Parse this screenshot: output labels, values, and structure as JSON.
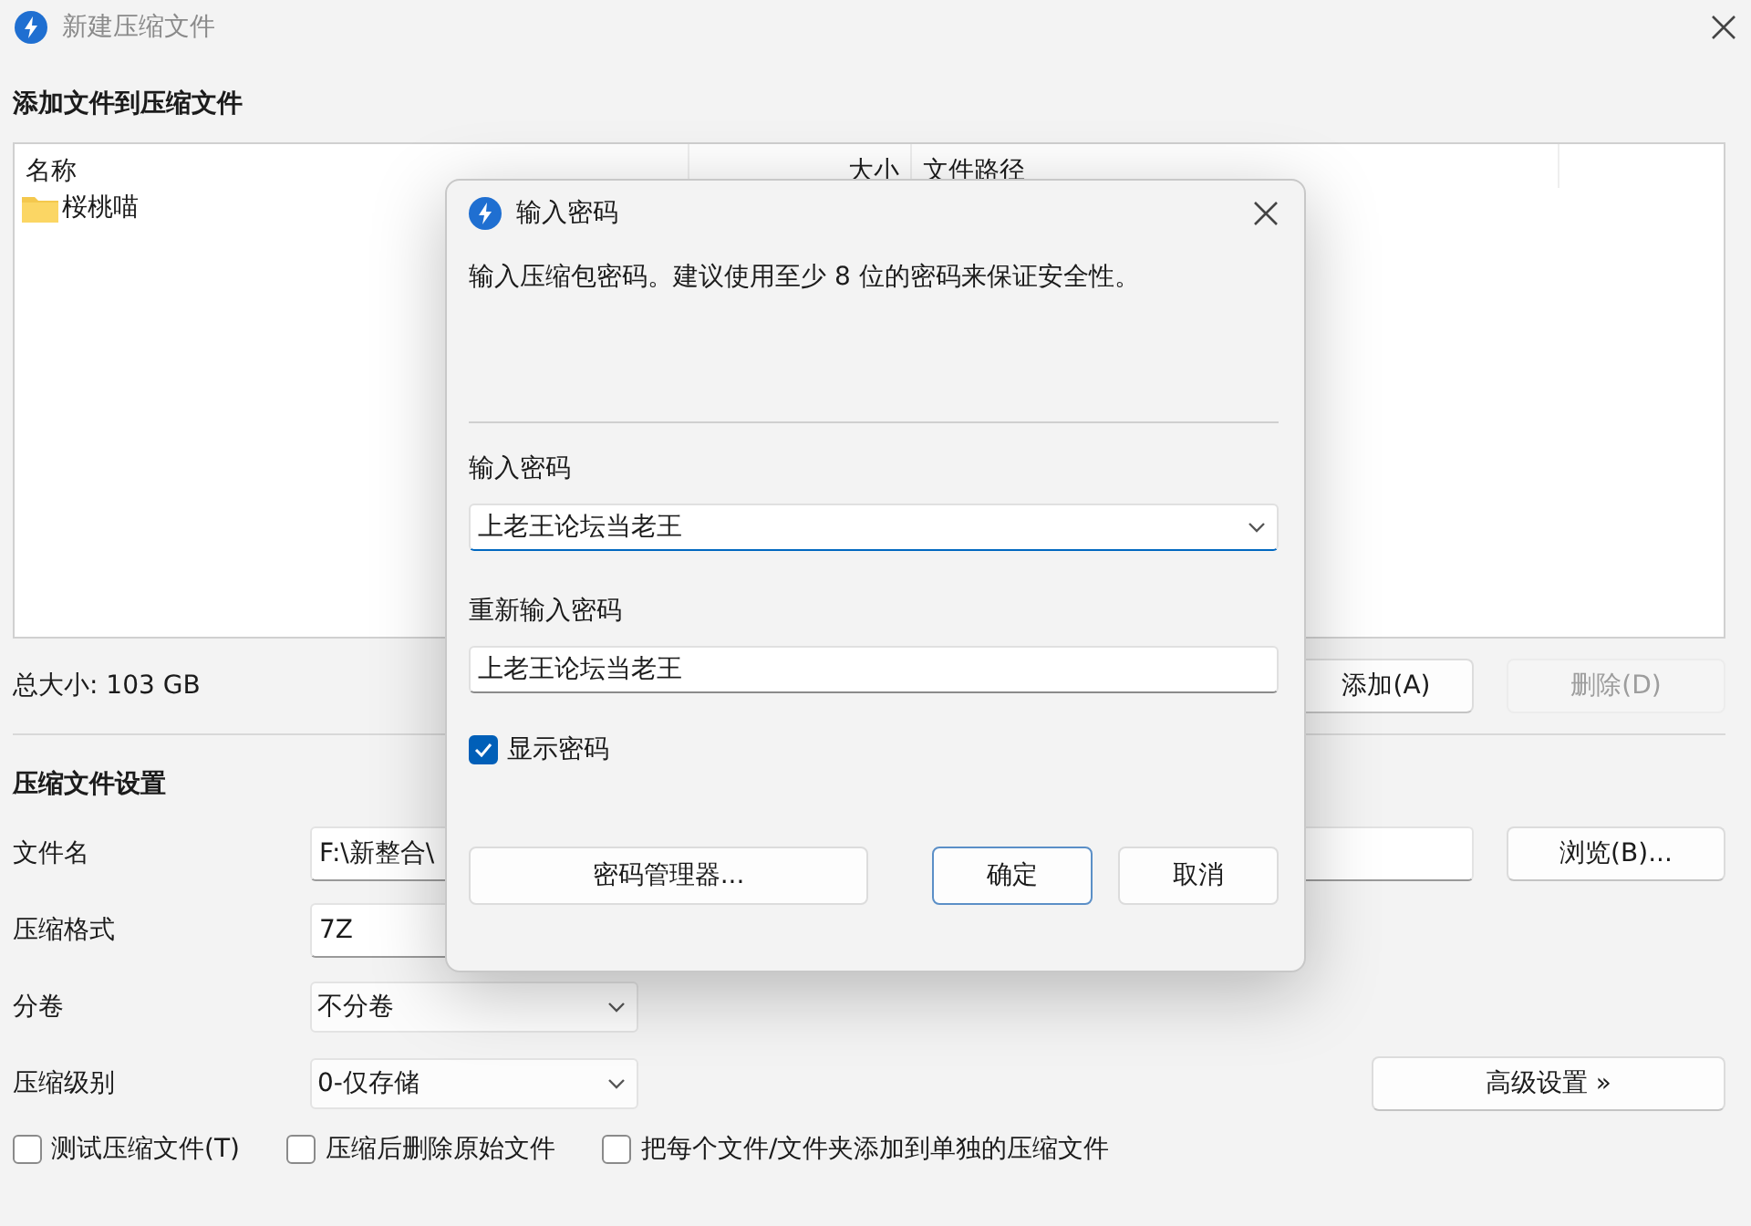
{
  "window": {
    "title": "新建压缩文件"
  },
  "files": {
    "heading": "添加文件到压缩文件",
    "columns": [
      "名称",
      "大小",
      "文件路径"
    ],
    "rows": [
      {
        "name": "桜桃喵",
        "kind": "folder"
      }
    ],
    "total": "总大小: 103 GB",
    "buttons": [
      {
        "label": "添加(A)",
        "disabled": false
      },
      {
        "label": "删除(D)",
        "disabled": true
      }
    ]
  },
  "settings": {
    "heading": "压缩文件设置",
    "fields": [
      {
        "label": "文件名",
        "kind": "text",
        "value": "F:\\新整合\\",
        "button": "浏览(B)..."
      },
      {
        "label": "压缩格式",
        "kind": "text",
        "value": "7Z"
      },
      {
        "label": "分卷",
        "kind": "select",
        "value": "不分卷"
      },
      {
        "label": "压缩级别",
        "kind": "select",
        "value": "0-仅存储",
        "button": "高级设置 »"
      }
    ],
    "options": [
      {
        "label": "测试压缩文件(T)",
        "checked": false
      },
      {
        "label": "压缩后删除原始文件",
        "checked": false
      },
      {
        "label": "把每个文件/文件夹添加到单独的压缩文件",
        "checked": false
      }
    ]
  },
  "dialog": {
    "title": "输入密码",
    "description": "输入压缩包密码。建议使用至少 8 位的密码来保证安全性。",
    "password_label": "输入密码",
    "password": "上老王论坛当老王",
    "confirm_label": "重新输入密码",
    "confirm": "上老王论坛当老王",
    "show_password": {
      "label": "显示密码",
      "checked": true
    },
    "buttons": [
      {
        "label": "密码管理器...",
        "default": false,
        "kind": "wide"
      },
      {
        "label": "确定",
        "default": true,
        "kind": "normal"
      },
      {
        "label": "取消",
        "default": false,
        "kind": "normal"
      }
    ]
  }
}
